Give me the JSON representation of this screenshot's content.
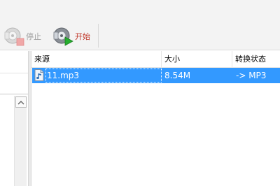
{
  "toolbar": {
    "stop_label": "停止",
    "start_label": "开始"
  },
  "list": {
    "columns": [
      "来源",
      "大小",
      "转换状态"
    ],
    "rows": [
      {
        "source": "11.mp3",
        "size": "8.54M",
        "status": "-> MP3",
        "selected": true
      }
    ]
  },
  "colors": {
    "selection": "#3399ff",
    "start_label": "#c0392b",
    "disabled_label": "#a0a0a0"
  }
}
